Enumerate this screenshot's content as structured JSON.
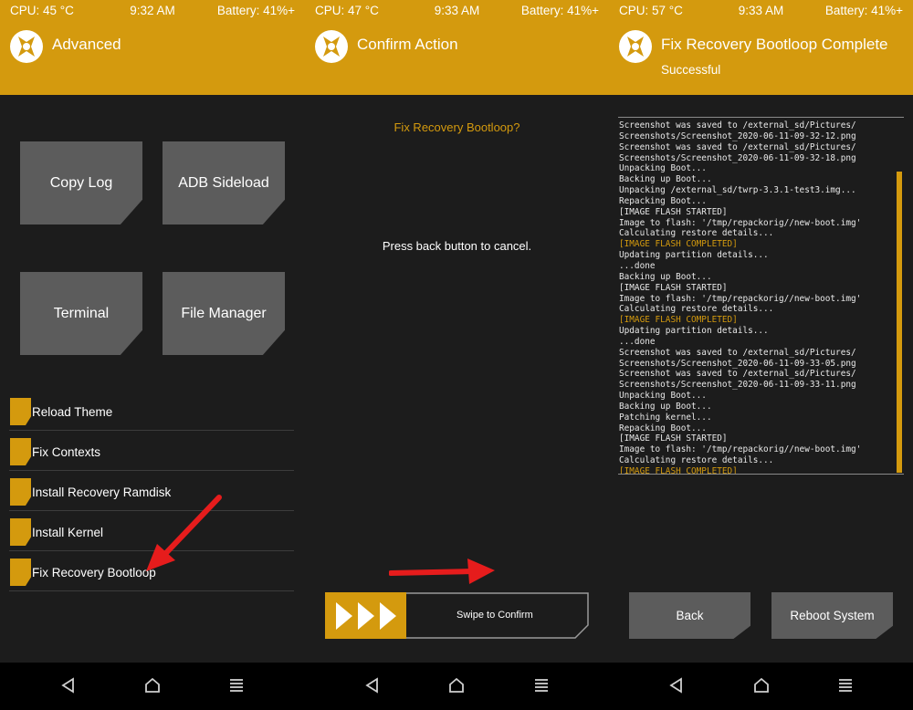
{
  "colors": {
    "accent": "#d49a0e",
    "button_grey": "#5c5c5c",
    "background": "#1c1c1c",
    "arrow_red": "#e61c1c"
  },
  "panels": [
    {
      "status": {
        "cpu": "CPU: 45 °C",
        "time": "9:32 AM",
        "battery": "Battery: 41%+"
      },
      "title": "Advanced",
      "buttons": [
        "Copy Log",
        "ADB Sideload",
        "Terminal",
        "File Manager"
      ],
      "list": [
        "Reload Theme",
        "Fix Contexts",
        "Install Recovery Ramdisk",
        "Install Kernel",
        "Fix Recovery Bootloop"
      ]
    },
    {
      "status": {
        "cpu": "CPU: 47 °C",
        "time": "9:33 AM",
        "battery": "Battery: 41%+"
      },
      "title": "Confirm Action",
      "question": "Fix Recovery Bootloop?",
      "note": "Press back button to cancel.",
      "swipe_label": "Swipe to Confirm"
    },
    {
      "status": {
        "cpu": "CPU: 57 °C",
        "time": "9:33 AM",
        "battery": "Battery: 41%+"
      },
      "title": "Fix Recovery Bootloop Complete",
      "subtitle": "Successful",
      "log": [
        {
          "t": "Screenshot was saved to /external_sd/Pictures/",
          "hl": false
        },
        {
          "t": "Screenshots/Screenshot_2020-06-11-09-32-12.png",
          "hl": false
        },
        {
          "t": "Screenshot was saved to /external_sd/Pictures/",
          "hl": false
        },
        {
          "t": "Screenshots/Screenshot_2020-06-11-09-32-18.png",
          "hl": false
        },
        {
          "t": "Unpacking Boot...",
          "hl": false
        },
        {
          "t": "Backing up Boot...",
          "hl": false
        },
        {
          "t": "Unpacking /external_sd/twrp-3.3.1-test3.img...",
          "hl": false
        },
        {
          "t": "Repacking Boot...",
          "hl": false
        },
        {
          "t": "[IMAGE FLASH STARTED]",
          "hl": false
        },
        {
          "t": "Image to flash: '/tmp/repackorig//new-boot.img'",
          "hl": false
        },
        {
          "t": "Calculating restore details...",
          "hl": false
        },
        {
          "t": "[IMAGE FLASH COMPLETED]",
          "hl": true
        },
        {
          "t": "Updating partition details...",
          "hl": false
        },
        {
          "t": "...done",
          "hl": false
        },
        {
          "t": "Backing up Boot...",
          "hl": false
        },
        {
          "t": "[IMAGE FLASH STARTED]",
          "hl": false
        },
        {
          "t": "Image to flash: '/tmp/repackorig//new-boot.img'",
          "hl": false
        },
        {
          "t": "Calculating restore details...",
          "hl": false
        },
        {
          "t": "[IMAGE FLASH COMPLETED]",
          "hl": true
        },
        {
          "t": "Updating partition details...",
          "hl": false
        },
        {
          "t": "...done",
          "hl": false
        },
        {
          "t": "Screenshot was saved to /external_sd/Pictures/",
          "hl": false
        },
        {
          "t": "Screenshots/Screenshot_2020-06-11-09-33-05.png",
          "hl": false
        },
        {
          "t": "Screenshot was saved to /external_sd/Pictures/",
          "hl": false
        },
        {
          "t": "Screenshots/Screenshot_2020-06-11-09-33-11.png",
          "hl": false
        },
        {
          "t": "Unpacking Boot...",
          "hl": false
        },
        {
          "t": "Backing up Boot...",
          "hl": false
        },
        {
          "t": "Patching kernel...",
          "hl": false
        },
        {
          "t": "Repacking Boot...",
          "hl": false
        },
        {
          "t": "[IMAGE FLASH STARTED]",
          "hl": false
        },
        {
          "t": "Image to flash: '/tmp/repackorig//new-boot.img'",
          "hl": false
        },
        {
          "t": "Calculating restore details...",
          "hl": false
        },
        {
          "t": "[IMAGE FLASH COMPLETED]",
          "hl": true
        }
      ],
      "buttons": [
        "Back",
        "Reboot System"
      ]
    }
  ],
  "navbar": {
    "icons": [
      "back-icon",
      "home-icon",
      "menu-icon"
    ]
  }
}
